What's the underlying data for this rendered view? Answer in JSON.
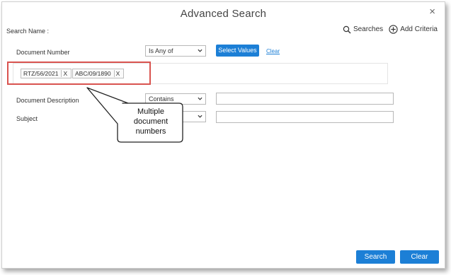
{
  "dialog": {
    "title": "Advanced Search",
    "close_glyph": "×",
    "search_name_label": "Search Name :",
    "searches_label": "Searches",
    "add_criteria_label": "Add Criteria"
  },
  "criteria": [
    {
      "label": "Document Number",
      "operator": "Is Any of",
      "select_values_label": "Select Values",
      "clear_label": "Clear"
    },
    {
      "label": "Document Description",
      "operator": "Contains",
      "value": ""
    },
    {
      "label": "Subject",
      "operator": "",
      "value": ""
    }
  ],
  "tags": [
    {
      "text": "RTZ/56/2021",
      "remove": "X"
    },
    {
      "text": "ABC/09/1890",
      "remove": "X"
    }
  ],
  "callout": {
    "line1": "Multiple",
    "line2": "document",
    "line3": "numbers"
  },
  "footer": {
    "search_button": "Search",
    "clear_button": "Clear"
  },
  "colors": {
    "accent": "#1c7fd6",
    "highlight": "#d9534f"
  },
  "icons": [
    "search-icon",
    "plus-circle-icon",
    "close-icon",
    "chevron-down-icon"
  ]
}
